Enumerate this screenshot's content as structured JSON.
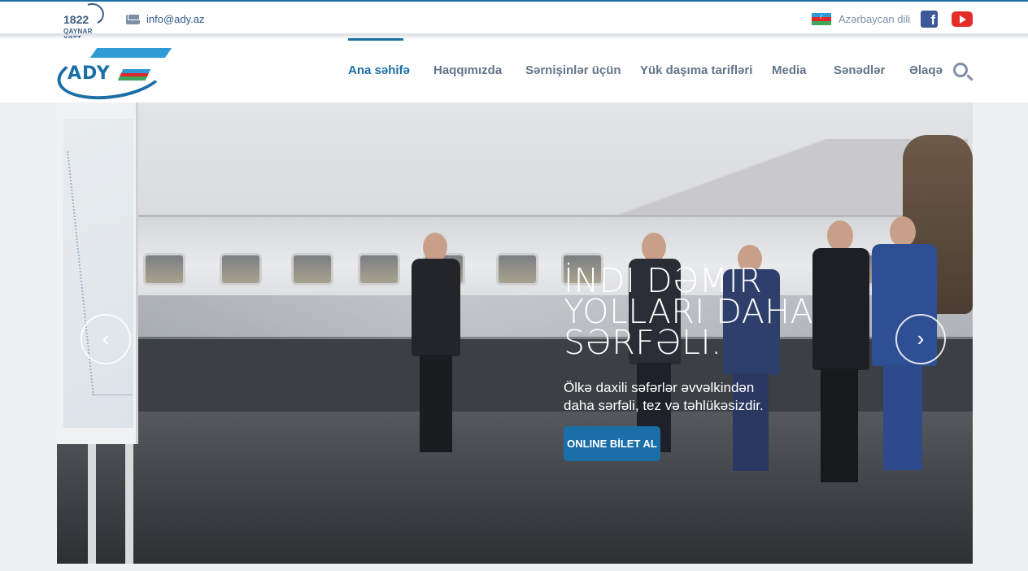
{
  "topbar": {
    "hotline_number": "1822",
    "hotline_label": "QAYNAR XƏTT",
    "email": "info@ady.az",
    "language": "Azərbaycan dili",
    "facebook_letter": "f"
  },
  "brand": {
    "logo_text": "ADY"
  },
  "nav": {
    "items": [
      {
        "label": "Ana səhifə",
        "active": true
      },
      {
        "label": "Haqqımızda"
      },
      {
        "label": "Sərnişinlər üçün"
      },
      {
        "label": "Yük daşıma tarifləri"
      },
      {
        "label": "Media"
      },
      {
        "label": "Sənədlər"
      },
      {
        "label": "Əlaqə"
      }
    ]
  },
  "hero": {
    "title": "İndi dəmir yolları daha sərfəli.",
    "subtitle": "Ölkə daxili səfərlər əvvəlkindən daha sərfəli, tez və təhlükəsizdir.",
    "cta_label": "ONLINE BİLET AL",
    "prev_icon": "‹",
    "next_icon": "›"
  },
  "colors": {
    "accent": "#1a6fa8",
    "nav_text": "#63748a",
    "facebook": "#3b5998",
    "youtube": "#e52d27"
  }
}
